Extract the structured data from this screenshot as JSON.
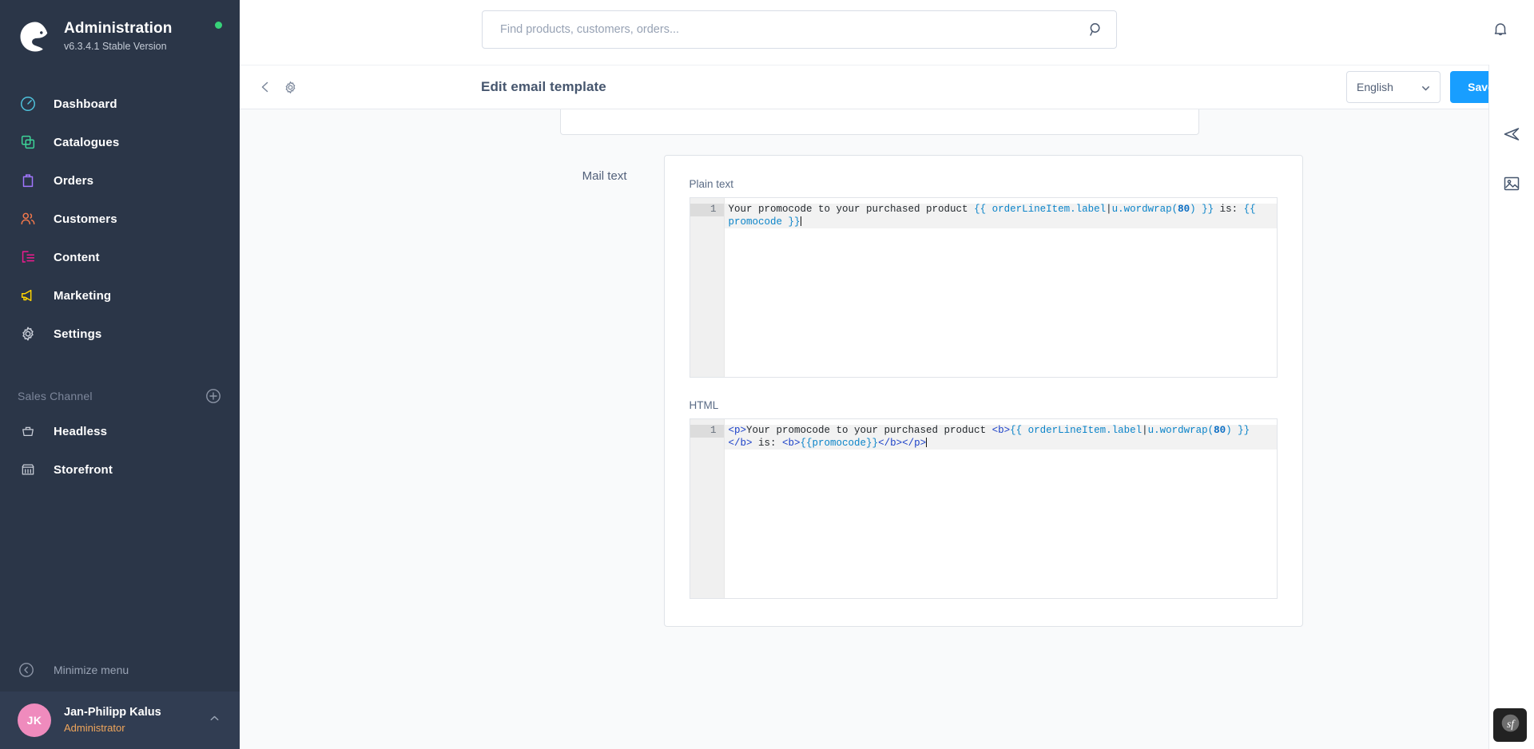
{
  "sidebar": {
    "brand": {
      "title": "Administration",
      "version": "v6.3.4.1 Stable Version"
    },
    "nav": [
      {
        "label": "Dashboard",
        "icon": "dashboard-icon"
      },
      {
        "label": "Catalogues",
        "icon": "catalogues-icon"
      },
      {
        "label": "Orders",
        "icon": "orders-icon"
      },
      {
        "label": "Customers",
        "icon": "customers-icon"
      },
      {
        "label": "Content",
        "icon": "content-icon"
      },
      {
        "label": "Marketing",
        "icon": "marketing-icon"
      },
      {
        "label": "Settings",
        "icon": "settings-gear-icon"
      }
    ],
    "sales_channel": {
      "title": "Sales Channel",
      "add_icon": "plus-circle-icon",
      "items": [
        {
          "label": "Headless",
          "icon": "basket-icon"
        },
        {
          "label": "Storefront",
          "icon": "storefront-icon"
        }
      ]
    },
    "minimize": {
      "label": "Minimize menu",
      "icon": "chevron-left-circle-icon"
    },
    "user": {
      "initials": "JK",
      "name": "Jan-Philipp Kalus",
      "role": "Administrator",
      "caret_icon": "chevron-up-icon"
    }
  },
  "topbar": {
    "search": {
      "placeholder": "Find products, customers, orders...",
      "value": "",
      "icon": "search-icon"
    },
    "notifications_icon": "bell-icon"
  },
  "smartbar": {
    "back_icon": "chevron-left-icon",
    "settings_icon": "gear-icon",
    "title": "Edit email template",
    "language": {
      "value": "English",
      "caret_icon": "chevron-down-icon"
    },
    "save_label": "Save"
  },
  "main": {
    "section_label": "Mail text",
    "plain_text": {
      "field_label": "Plain text",
      "line_number": "1",
      "content": "Your promocode to your purchased product {{ orderLineItem.label|u.wordwrap(80) }} is: {{ promocode }}",
      "segments": [
        {
          "text": "Your promocode to your purchased product ",
          "type": "plain"
        },
        {
          "text": "{{ orderLineItem.label",
          "type": "var"
        },
        {
          "text": "|",
          "type": "plain"
        },
        {
          "text": "u.wordwrap(",
          "type": "var"
        },
        {
          "text": "80",
          "type": "num"
        },
        {
          "text": ") }}",
          "type": "var"
        },
        {
          "text": " is: ",
          "type": "plain"
        },
        {
          "text": "{{ promocode }}",
          "type": "var"
        }
      ]
    },
    "html": {
      "field_label": "HTML",
      "line_number": "1",
      "content": "<p>Your promocode to your purchased product <b>{{ orderLineItem.label|u.wordwrap(80) }}</b> is: <b>{{promocode}}</b></p>",
      "segments": [
        {
          "text": "<p>",
          "type": "tag"
        },
        {
          "text": "Your promocode to your purchased product ",
          "type": "plain"
        },
        {
          "text": "<b>",
          "type": "tag"
        },
        {
          "text": "{{ orderLineItem.label",
          "type": "var"
        },
        {
          "text": "|",
          "type": "plain"
        },
        {
          "text": "u.wordwrap(",
          "type": "var"
        },
        {
          "text": "80",
          "type": "num"
        },
        {
          "text": ") }}",
          "type": "var"
        },
        {
          "text": "</b>",
          "type": "tag"
        },
        {
          "text": " is: ",
          "type": "plain"
        },
        {
          "text": "<b>",
          "type": "tag"
        },
        {
          "text": "{{promocode}}",
          "type": "var"
        },
        {
          "text": "</b>",
          "type": "tag"
        },
        {
          "text": "</p>",
          "type": "tag"
        }
      ]
    }
  },
  "rail": {
    "buttons": [
      {
        "icon": "send-mail-icon"
      },
      {
        "icon": "media-image-icon"
      }
    ]
  },
  "scrollbar": {
    "up_icon": "chevron-up-icon",
    "down_icon": "chevron-down-icon"
  },
  "debug_toolbar": {
    "icon": "symfony-icon"
  },
  "colors": {
    "sidebar_bg": "#2b3648",
    "accent_blue": "#189eff",
    "status_green": "#37d279",
    "avatar_pink": "#ef8bbd",
    "role_orange": "#f0a65b"
  }
}
